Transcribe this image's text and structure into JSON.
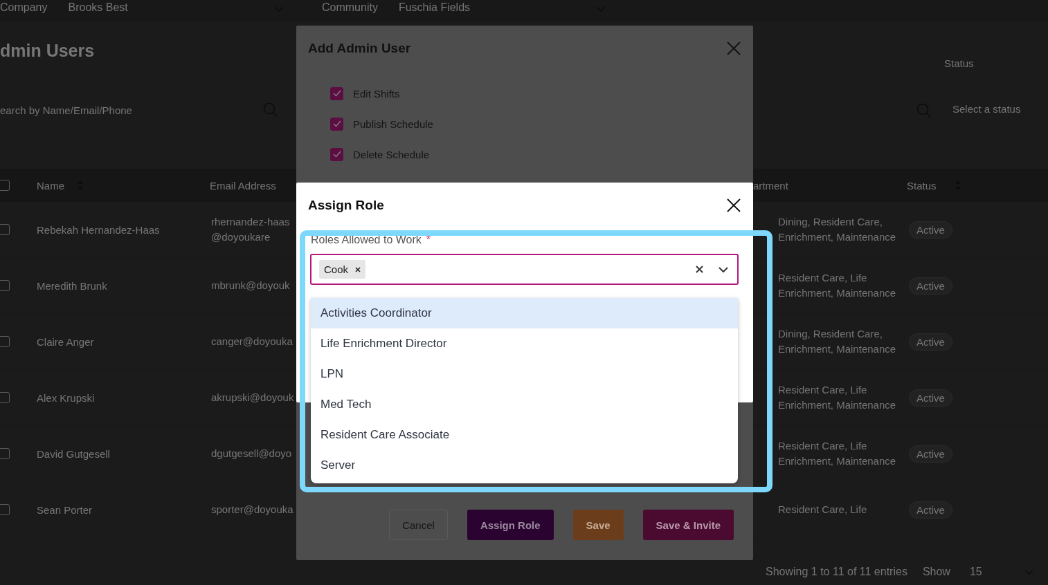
{
  "top_bar": {
    "filters": [
      {
        "label": "Company",
        "value": "Brooks Best"
      },
      {
        "label": "Community",
        "value": "Fuschia Fields"
      }
    ]
  },
  "page_title": "dmin Users",
  "search": {
    "placeholder": "earch by Name/Email/Phone"
  },
  "status_filter": {
    "label": "Status",
    "placeholder": "Select a status"
  },
  "table": {
    "select_all_checked": false,
    "columns": [
      "Name",
      "Email Address",
      "artment",
      "Status"
    ],
    "rows": [
      {
        "checked": false,
        "name": "Rebekah Hernandez-Haas",
        "email": "rhernandez-haas@doyoukare",
        "department": "Dining, Resident Care, Enrichment, Maintenance",
        "status": "Active"
      },
      {
        "checked": false,
        "name": "Meredith Brunk",
        "email": "mbrunk@doyouk",
        "department": "Resident Care, Life Enrichment, Maintenance",
        "status": "Active"
      },
      {
        "checked": false,
        "name": "Claire Anger",
        "email": "canger@doyouka",
        "department": "Dining, Resident Care, Enrichment, Maintenance",
        "status": "Active"
      },
      {
        "checked": false,
        "name": "Alex Krupski",
        "email": "akrupski@doyouk",
        "department": "Resident Care, Life Enrichment, Maintenance",
        "status": "Active"
      },
      {
        "checked": false,
        "name": "David Gutgesell",
        "email": "dgutgesell@doyo",
        "department": "Resident Care, Life Enrichment, Maintenance",
        "status": "Active"
      },
      {
        "checked": false,
        "name": "Sean Porter",
        "email": "sporter@doyouka",
        "department": "Resident Care, Life",
        "status": "Active"
      }
    ]
  },
  "footer": {
    "summary": "Showing 1 to 11 of 11 entries",
    "show_label": "Show",
    "page_size": "15"
  },
  "add_admin_dialog": {
    "title": "Add Admin User",
    "permissions": [
      {
        "label": "Edit Shifts",
        "checked": true
      },
      {
        "label": "Publish Schedule",
        "checked": true
      },
      {
        "label": "Delete Schedule",
        "checked": true
      }
    ],
    "buttons": [
      {
        "label": "Cancel",
        "kind": "outline"
      },
      {
        "label": "Assign Role",
        "kind": "dark"
      },
      {
        "label": "Save",
        "kind": "orange"
      },
      {
        "label": "Save & Invite",
        "kind": "magenta"
      }
    ]
  },
  "assign_role_dialog": {
    "title": "Assign Role",
    "field_label": "Roles Allowed to Work",
    "required_mark": "*",
    "chips": [
      "Cook"
    ],
    "options": [
      {
        "label": "Activities Coordinator",
        "highlighted": true
      },
      {
        "label": "Life Enrichment Director",
        "highlighted": false
      },
      {
        "label": "LPN",
        "highlighted": false
      },
      {
        "label": "Med Tech",
        "highlighted": false
      },
      {
        "label": "Resident Care Associate",
        "highlighted": false
      },
      {
        "label": "Server",
        "highlighted": false
      }
    ]
  }
}
